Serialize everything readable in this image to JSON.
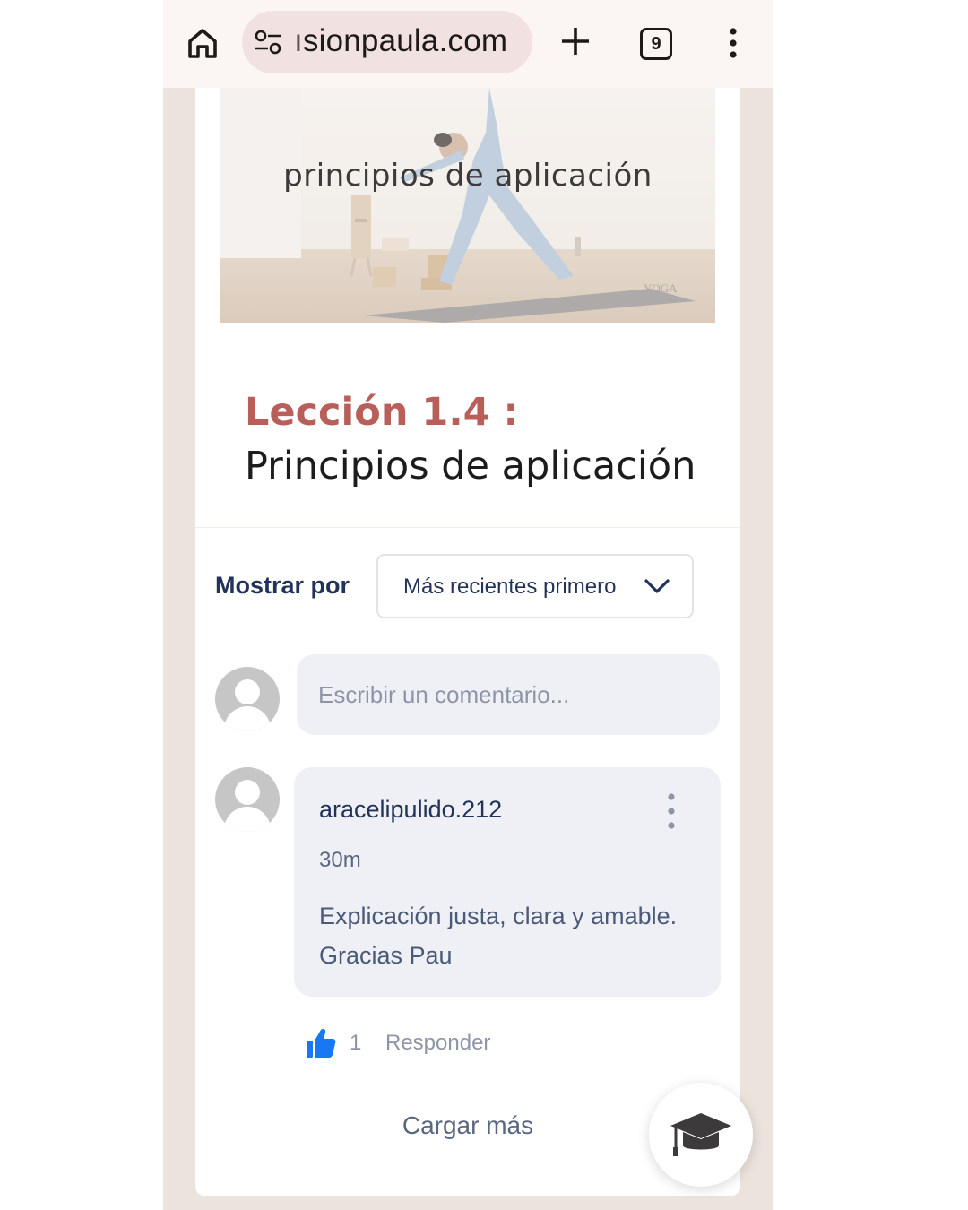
{
  "browser": {
    "url": "ısionpaula.com",
    "tab_count": "9",
    "icons": [
      "home-icon",
      "site-settings-icon",
      "new-tab-plus-icon",
      "tab-switcher-icon",
      "overflow-menu-icon"
    ]
  },
  "video": {
    "overlay_title": "principios de aplicación",
    "logo_text": "YOGA"
  },
  "lesson": {
    "number_label": "Lección 1.4 :",
    "title": "Principios de aplicación"
  },
  "comments": {
    "sort_label": "Mostrar por",
    "sort_value": "Más recientes primero",
    "input_placeholder": "Escribir un comentario...",
    "items": [
      {
        "author": "aracelipulido.212",
        "time": "30m",
        "text": "Explicación justa, clara y amable. Gracias Pau",
        "likes": "1",
        "reply_label": "Responder"
      }
    ],
    "load_more_label": "Cargar más"
  },
  "colors": {
    "accent": "#b85f5a",
    "navy": "#22335a",
    "like_blue": "#1877f2"
  }
}
